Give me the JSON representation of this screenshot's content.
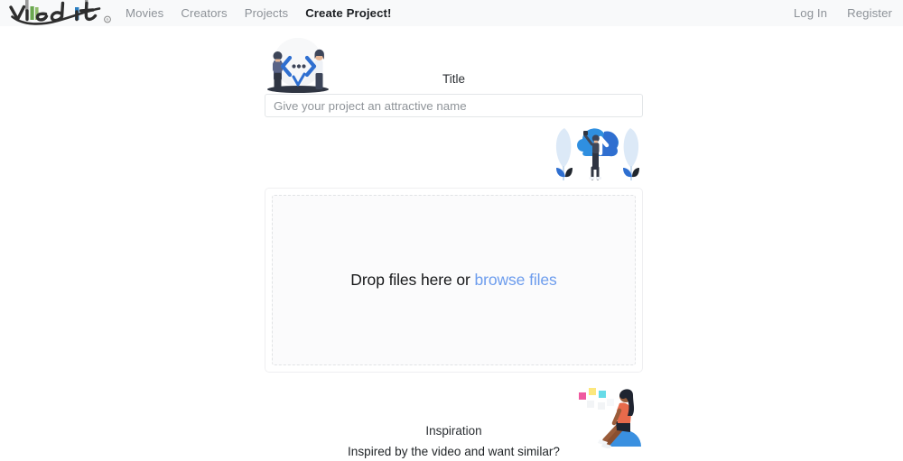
{
  "navbar": {
    "brand": {
      "text": "viedit",
      "registered_mark": "®"
    },
    "left_links": [
      {
        "label": "Movies",
        "active": false
      },
      {
        "label": "Creators",
        "active": false
      },
      {
        "label": "Projects",
        "active": false
      },
      {
        "label": "Create Project!",
        "active": true
      }
    ],
    "right_links": [
      {
        "label": "Log In"
      },
      {
        "label": "Register"
      }
    ],
    "background_color": "#f8f9fa"
  },
  "form": {
    "title_label": "Title",
    "title_placeholder": "Give your project an attractive name",
    "title_value": ""
  },
  "dropzone": {
    "prompt": "Drop files here or",
    "browse_label": "browse files",
    "browse_color": "#6c9ced"
  },
  "inspiration": {
    "label": "Inspiration",
    "question": "Inspired by the video and want similar?"
  },
  "illustrations": {
    "handshake": "two-people-exchange-illustration",
    "cloud_upload": "cloud-upload-illustration",
    "sitting_person": "person-sitting-on-ball-illustration"
  },
  "colors": {
    "accent_blue": "#1a73e8",
    "link_blue": "#6c9ced",
    "nav_text": "#8d9298",
    "nav_active": "#1c1f23",
    "logo_green": "#5fa832",
    "logo_blue": "#2b7ec1",
    "logo_gray": "#9a9a9a"
  }
}
